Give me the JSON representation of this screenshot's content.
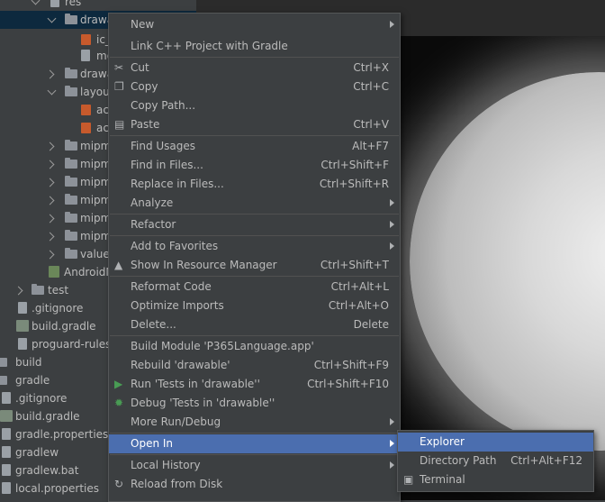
{
  "project_tree": {
    "items": [
      {
        "label": "res",
        "icon": "folder-icon"
      },
      {
        "label": "drawa",
        "icon": "folder-icon"
      },
      {
        "label": "ic_",
        "icon": "xml-file-icon"
      },
      {
        "label": "mo",
        "icon": "file-icon"
      },
      {
        "label": "drawa",
        "icon": "folder-icon"
      },
      {
        "label": "layou",
        "icon": "folder-icon"
      },
      {
        "label": "ac",
        "icon": "xml-file-icon"
      },
      {
        "label": "ac",
        "icon": "xml-file-icon"
      },
      {
        "label": "mipm",
        "icon": "folder-icon"
      },
      {
        "label": "mipm",
        "icon": "folder-icon"
      },
      {
        "label": "mipm",
        "icon": "folder-icon"
      },
      {
        "label": "mipm",
        "icon": "folder-icon"
      },
      {
        "label": "mipm",
        "icon": "folder-icon"
      },
      {
        "label": "mipm",
        "icon": "folder-icon"
      },
      {
        "label": "values",
        "icon": "folder-icon"
      },
      {
        "label": "AndroidM",
        "icon": "manifest-file-icon"
      },
      {
        "label": "test",
        "icon": "folder-icon"
      },
      {
        "label": ".gitignore",
        "icon": "file-icon"
      },
      {
        "label": "build.gradle",
        "icon": "gradle-file-icon"
      },
      {
        "label": "proguard-rules.p",
        "icon": "file-icon"
      },
      {
        "label": "build",
        "icon": "folder-icon"
      },
      {
        "label": "gradle",
        "icon": "folder-icon"
      },
      {
        "label": ".gitignore",
        "icon": "file-icon"
      },
      {
        "label": "build.gradle",
        "icon": "gradle-file-icon"
      },
      {
        "label": "gradle.properties",
        "icon": "file-icon"
      },
      {
        "label": "gradlew",
        "icon": "file-icon"
      },
      {
        "label": "gradlew.bat",
        "icon": "file-icon"
      },
      {
        "label": "local.properties",
        "icon": "file-icon"
      }
    ]
  },
  "context_menu": {
    "items": [
      {
        "label": "New",
        "shortcut": ""
      },
      {
        "label": "Link C++ Project with Gradle",
        "shortcut": ""
      },
      {
        "label": "Cut",
        "shortcut": "Ctrl+X",
        "icon": "scissors-icon"
      },
      {
        "label": "Copy",
        "shortcut": "Ctrl+C",
        "icon": "copy-icon"
      },
      {
        "label": "Copy Path...",
        "shortcut": ""
      },
      {
        "label": "Paste",
        "shortcut": "Ctrl+V",
        "icon": "paste-icon"
      },
      {
        "label": "Find Usages",
        "shortcut": "Alt+F7"
      },
      {
        "label": "Find in Files...",
        "shortcut": "Ctrl+Shift+F"
      },
      {
        "label": "Replace in Files...",
        "shortcut": "Ctrl+Shift+R"
      },
      {
        "label": "Analyze",
        "shortcut": ""
      },
      {
        "label": "Refactor",
        "shortcut": ""
      },
      {
        "label": "Add to Favorites",
        "shortcut": ""
      },
      {
        "label": "Show In Resource Manager",
        "shortcut": "Ctrl+Shift+T",
        "icon": "resource-manager-icon"
      },
      {
        "label": "Reformat Code",
        "shortcut": "Ctrl+Alt+L"
      },
      {
        "label": "Optimize Imports",
        "shortcut": "Ctrl+Alt+O"
      },
      {
        "label": "Delete...",
        "shortcut": "Delete"
      },
      {
        "label": "Build Module 'P365Language.app'",
        "shortcut": ""
      },
      {
        "label": "Rebuild 'drawable'",
        "shortcut": "Ctrl+Shift+F9"
      },
      {
        "label": "Run 'Tests in 'drawable''",
        "shortcut": "Ctrl+Shift+F10",
        "icon": "run-icon"
      },
      {
        "label": "Debug 'Tests in 'drawable''",
        "shortcut": "",
        "icon": "debug-icon"
      },
      {
        "label": "More Run/Debug",
        "shortcut": ""
      },
      {
        "label": "Open In",
        "shortcut": ""
      },
      {
        "label": "Local History",
        "shortcut": ""
      },
      {
        "label": "Reload from Disk",
        "shortcut": "",
        "icon": "reload-icon"
      }
    ]
  },
  "submenu": {
    "items": [
      {
        "label": "Explorer",
        "shortcut": ""
      },
      {
        "label": "Directory Path",
        "shortcut": "Ctrl+Alt+F12"
      },
      {
        "label": "Terminal",
        "shortcut": "",
        "icon": "terminal-icon"
      }
    ]
  },
  "colors": {
    "menu_bg": "#3c3f41",
    "highlight": "#4b6eaf",
    "tree_selection": "#0d293e",
    "run_green": "#499c54",
    "xml_orange": "#c75a2c"
  }
}
